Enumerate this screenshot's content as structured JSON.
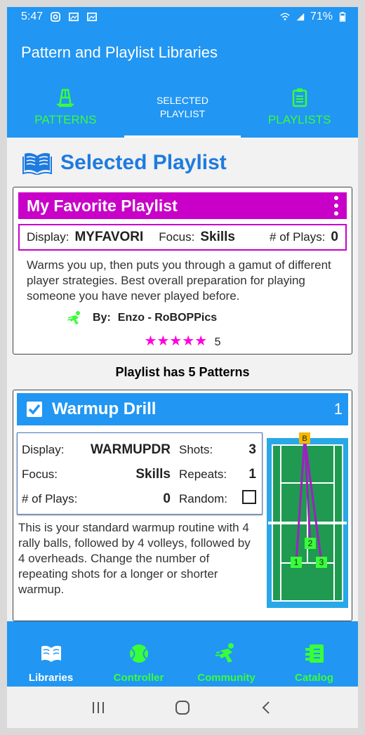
{
  "status_bar": {
    "time": "5:47",
    "battery": "71%",
    "icons": [
      "instagram-icon",
      "photo-icon",
      "photo-icon",
      "wifi-icon",
      "signal-icon",
      "battery-icon"
    ]
  },
  "app_bar": {
    "title": "Pattern and Playlist Libraries"
  },
  "tabs": [
    {
      "label": "PATTERNS",
      "icon": "court-icon"
    },
    {
      "label_line1": "SELECTED",
      "label_line2": "PLAYLIST"
    },
    {
      "label": "PLAYLISTS",
      "icon": "clipboard-icon"
    }
  ],
  "section": {
    "title": "Selected Playlist",
    "icon": "open-book-icon"
  },
  "playlist": {
    "name": "My Favorite Playlist",
    "display_label": "Display:",
    "display_value": "MYFAVORI",
    "focus_label": "Focus:",
    "focus_value": "Skills",
    "plays_label": "# of Plays:",
    "plays_value": "0",
    "description": "Warms you up, then puts you through a gamut of different player strategies. Best overall preparation for playing someone you have never played before.",
    "by_label": "By:",
    "author": "Enzo - RoBOPPics",
    "stars": "★★★★★",
    "rating": "5",
    "pattern_count_text": "Playlist has 5 Patterns"
  },
  "pattern": {
    "name": "Warmup Drill",
    "index": "1",
    "display_label": "Display:",
    "display_value": "WARMUPDR",
    "shots_label": "Shots:",
    "shots_value": "3",
    "focus_label": "Focus:",
    "focus_value": "Skills",
    "repeats_label": "Repeats:",
    "repeats_value": "1",
    "plays_label": "# of Plays:",
    "plays_value": "0",
    "random_label": "Random:",
    "random_checked": false,
    "description": "This is your standard warmup routine with 4 rally balls, followed by 4 volleys, followed by 4 overheads. Change the number of repeating shots for a longer or shorter warmup.",
    "court_labels": {
      "ball_machine": "B",
      "shot1": "1",
      "shot2": "2",
      "shot3": "3"
    }
  },
  "bottom_nav": [
    {
      "label": "Libraries",
      "icon": "open-book-icon",
      "active": true
    },
    {
      "label": "Controller",
      "icon": "tennis-ball-icon",
      "active": false
    },
    {
      "label": "Community",
      "icon": "player-icon",
      "active": false
    },
    {
      "label": "Catalog",
      "icon": "catalog-icon",
      "active": false
    }
  ],
  "colors": {
    "primary": "#2196f3",
    "accent_green": "#39ff39",
    "playlist_magenta": "#c800c8",
    "title_blue": "#1e7be0",
    "star_pink": "#ff00dd"
  }
}
